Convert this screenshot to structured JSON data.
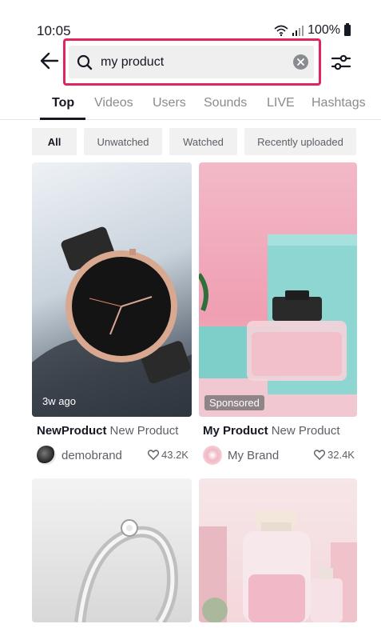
{
  "status_bar": {
    "time": "10:05",
    "battery": "100%"
  },
  "search": {
    "query": "my product",
    "highlight_color": "#e0245e"
  },
  "tabs": [
    {
      "label": "Top",
      "active": true
    },
    {
      "label": "Videos"
    },
    {
      "label": "Users"
    },
    {
      "label": "Sounds"
    },
    {
      "label": "LIVE"
    },
    {
      "label": "Hashtags"
    }
  ],
  "filters": [
    {
      "label": "All",
      "active": true
    },
    {
      "label": "Unwatched"
    },
    {
      "label": "Watched"
    },
    {
      "label": "Recently uploaded"
    }
  ],
  "results": [
    {
      "overlay": "3w ago",
      "title": "NewProduct",
      "subtitle": "New Product",
      "author": "demobrand",
      "likes": "43.2K",
      "thumbnail": "watch"
    },
    {
      "overlay": "Sponsored",
      "title": "My Product",
      "subtitle": "New Product",
      "author": "My Brand",
      "likes": "32.4K",
      "thumbnail": "perfume"
    },
    {
      "thumbnail": "ring"
    },
    {
      "thumbnail": "bottle"
    }
  ]
}
